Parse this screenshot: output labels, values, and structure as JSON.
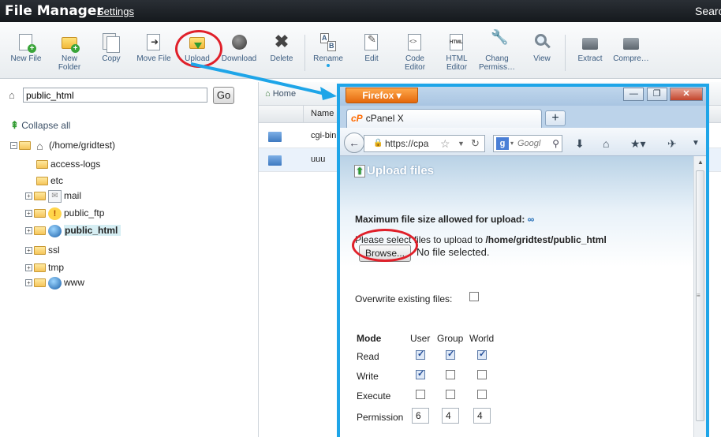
{
  "header": {
    "title": "File Manager",
    "settings_link": "Settings",
    "search_label": "Searc"
  },
  "toolbar": {
    "items": [
      {
        "label": "New File",
        "icon": "new-file-icon"
      },
      {
        "label": "New\nFolder",
        "icon": "new-folder-icon"
      },
      {
        "label": "Copy",
        "icon": "copy-icon"
      },
      {
        "label": "Move File",
        "icon": "move-file-icon"
      },
      {
        "label": "Upload",
        "icon": "upload-icon"
      },
      {
        "label": "Download",
        "icon": "download-icon"
      },
      {
        "label": "Delete",
        "icon": "delete-icon"
      },
      {
        "label": "Rename",
        "icon": "rename-icon"
      },
      {
        "label": "Edit",
        "icon": "edit-icon"
      },
      {
        "label": "Code\nEditor",
        "icon": "code-editor-icon"
      },
      {
        "label": "HTML\nEditor",
        "icon": "html-editor-icon"
      },
      {
        "label": "Chang\nPermiss…",
        "icon": "permissions-icon"
      },
      {
        "label": "View",
        "icon": "view-icon"
      },
      {
        "label": "Extract",
        "icon": "extract-icon"
      },
      {
        "label": "Compre…",
        "icon": "compress-icon"
      }
    ]
  },
  "pathbar": {
    "value": "public_html",
    "go_label": "Go"
  },
  "tree": {
    "collapse_all": "Collapse all",
    "root": "(/home/gridtest)",
    "items": [
      {
        "label": "access-logs"
      },
      {
        "label": "etc"
      },
      {
        "label": "mail"
      },
      {
        "label": "public_ftp"
      },
      {
        "label": "public_html"
      },
      {
        "label": "ssl"
      },
      {
        "label": "tmp"
      },
      {
        "label": "www"
      }
    ]
  },
  "rightpanel": {
    "home_label": "Home",
    "column_name": "Name",
    "rows": [
      {
        "name": "cgi-bin"
      },
      {
        "name": "uuu"
      }
    ]
  },
  "firefox": {
    "menu_button": "Firefox ▾",
    "tab_title": "cPanel X",
    "tab_logo": "cP",
    "url": "https://cpa",
    "search_placeholder": "Googl",
    "search_engine": "g",
    "window_controls": [
      "—",
      "❐",
      "✕"
    ],
    "new_tab": "+"
  },
  "upload_form": {
    "title": "Upload files",
    "max_size_label": "Maximum file size allowed for upload:",
    "max_size_value": "∞",
    "select_prefix": "Please select files to upload to ",
    "select_path": "/home/gridtest/public_html",
    "browse_label": "Browse...",
    "no_file": "No file selected.",
    "overwrite_label": "Overwrite existing files:",
    "overwrite_checked": false,
    "perm_header": {
      "mode": "Mode",
      "user": "User",
      "group": "Group",
      "world": "World"
    },
    "perm_rows": [
      {
        "label": "Read",
        "user": true,
        "group": true,
        "world": true
      },
      {
        "label": "Write",
        "user": true,
        "group": false,
        "world": false
      },
      {
        "label": "Execute",
        "user": false,
        "group": false,
        "world": false
      }
    ],
    "permission_label": "Permission",
    "permission_values": [
      "6",
      "4",
      "4"
    ]
  },
  "colors": {
    "annotation_red": "#e0202a",
    "annotation_blue": "#1ea5e8",
    "toolbar_text": "#3b5c80"
  }
}
